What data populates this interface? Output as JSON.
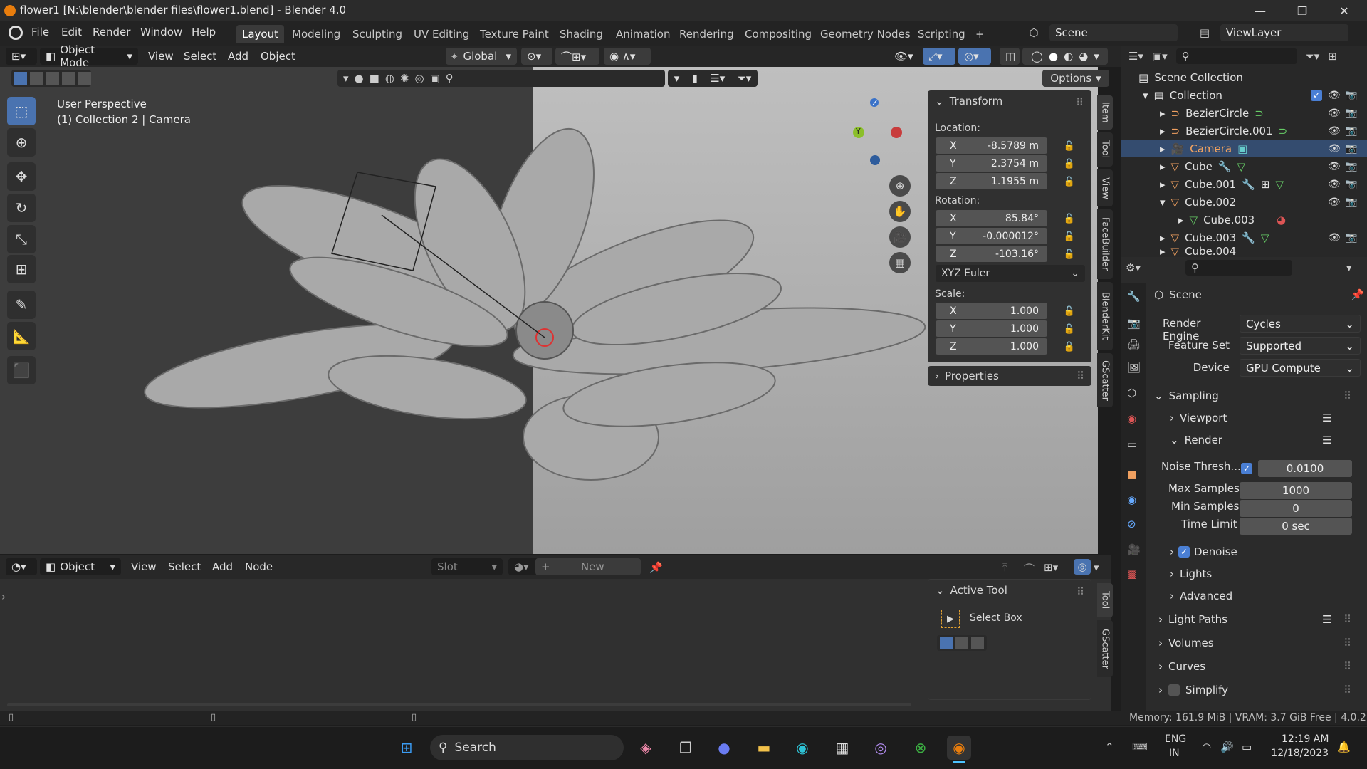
{
  "window": {
    "title": "flower1 [N:\\blender\\blender files\\flower1.blend] - Blender 4.0",
    "minimize": "—",
    "maximize": "❐",
    "close": "✕"
  },
  "menu": [
    "File",
    "Edit",
    "Render",
    "Window",
    "Help"
  ],
  "workspaces": [
    "Layout",
    "Modeling",
    "Sculpting",
    "UV Editing",
    "Texture Paint",
    "Shading",
    "Animation",
    "Rendering",
    "Compositing",
    "Geometry Nodes",
    "Scripting"
  ],
  "workspace_add": "+",
  "scene": {
    "label": "Scene",
    "viewlayer": "ViewLayer"
  },
  "viewport_header": {
    "mode": "Object Mode",
    "menus": [
      "View",
      "Select",
      "Add",
      "Object"
    ],
    "orientation": "Global",
    "options": "Options"
  },
  "viewport": {
    "perspective": "User Perspective",
    "info": "(1) Collection 2 | Camera",
    "gizmo": {
      "z": "Z",
      "y": "Y"
    }
  },
  "side_tabs": [
    "Item",
    "Tool",
    "View",
    "FaceBuilder",
    "BlenderKit",
    "GScatter"
  ],
  "transform": {
    "header": "Transform",
    "location_label": "Location:",
    "location": [
      {
        "axis": "X",
        "value": "-8.5789 m"
      },
      {
        "axis": "Y",
        "value": "2.3754 m"
      },
      {
        "axis": "Z",
        "value": "1.1955 m"
      }
    ],
    "rotation_label": "Rotation:",
    "rotation": [
      {
        "axis": "X",
        "value": "85.84°"
      },
      {
        "axis": "Y",
        "value": "-0.000012°"
      },
      {
        "axis": "Z",
        "value": "-103.16°"
      }
    ],
    "rotation_mode": "XYZ Euler",
    "scale_label": "Scale:",
    "scale": [
      {
        "axis": "X",
        "value": "1.000"
      },
      {
        "axis": "Y",
        "value": "1.000"
      },
      {
        "axis": "Z",
        "value": "1.000"
      }
    ],
    "properties": "Properties"
  },
  "outliner": {
    "root": "Scene Collection",
    "collection": "Collection",
    "items": [
      {
        "name": "BezierCircle",
        "selected": false
      },
      {
        "name": "BezierCircle.001",
        "selected": false
      },
      {
        "name": "Camera",
        "selected": true
      },
      {
        "name": "Cube",
        "selected": false
      },
      {
        "name": "Cube.001",
        "selected": false
      },
      {
        "name": "Cube.002",
        "selected": false
      },
      {
        "name": "Cube.003",
        "selected": false,
        "child": true
      },
      {
        "name": "Cube.003",
        "selected": false
      },
      {
        "name": "Cube.004",
        "selected": false
      }
    ]
  },
  "properties": {
    "header": "Scene",
    "render_engine_label": "Render Engine",
    "render_engine": "Cycles",
    "feature_set_label": "Feature Set",
    "feature_set": "Supported",
    "device_label": "Device",
    "device": "GPU Compute",
    "sampling": "Sampling",
    "viewport": "Viewport",
    "render": "Render",
    "noise_label": "Noise Thresh...",
    "noise_value": "0.0100",
    "max_samples_label": "Max Samples",
    "max_samples": "1000",
    "min_samples_label": "Min Samples",
    "min_samples": "0",
    "time_limit_label": "Time Limit",
    "time_limit": "0 sec",
    "denoise": "Denoise",
    "lights": "Lights",
    "advanced": "Advanced",
    "light_paths": "Light Paths",
    "volumes": "Volumes",
    "curves": "Curves",
    "simplify": "Simplify"
  },
  "shader_header": {
    "mode": "Object",
    "menus": [
      "View",
      "Select",
      "Add",
      "Node"
    ],
    "slot": "Slot",
    "new": "New"
  },
  "active_tool": {
    "header": "Active Tool",
    "name": "Select Box"
  },
  "shader_tabs": [
    "Tool",
    "GScatter"
  ],
  "status": "Memory: 161.9 MiB | VRAM: 3.7 GiB Free | 4.0.2",
  "taskbar": {
    "search": "Search",
    "lang1": "ENG",
    "lang2": "IN",
    "time": "12:19 AM",
    "date": "12/18/2023"
  },
  "colors": {
    "accent": "#4a73b0",
    "selected_row": "#344c6f",
    "x_axis": "#c83c3c",
    "y_axis": "#8bbf2a",
    "z_axis": "#3a72c8"
  }
}
